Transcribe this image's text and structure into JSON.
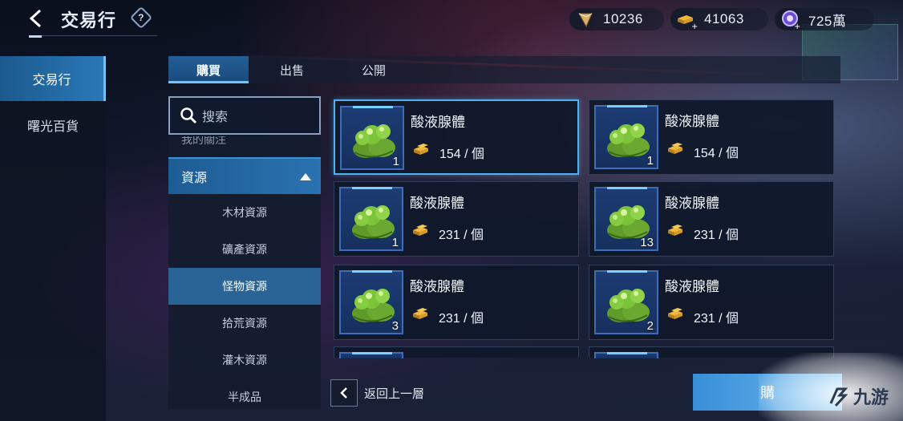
{
  "header": {
    "title": "交易行",
    "help": "?"
  },
  "currencies": [
    {
      "icon": "gem-icon",
      "value": "10236"
    },
    {
      "icon": "gold-bars-add-icon",
      "value": "41063"
    },
    {
      "icon": "crystal-add-icon",
      "value": "725萬"
    }
  ],
  "sidebar": {
    "items": [
      {
        "label": "交易行",
        "active": true
      },
      {
        "label": "曙光百貨",
        "active": false
      }
    ]
  },
  "tabs": [
    {
      "label": "購買",
      "active": true
    },
    {
      "label": "出售",
      "active": false
    },
    {
      "label": "公開",
      "active": false
    }
  ],
  "search": {
    "placeholder": "搜索"
  },
  "categories": {
    "cut_item": "我的關注",
    "group": "資源",
    "items": [
      {
        "label": "木材資源"
      },
      {
        "label": "礦產資源"
      },
      {
        "label": "怪物資源",
        "active": true
      },
      {
        "label": "拾荒資源"
      },
      {
        "label": "灌木資源"
      },
      {
        "label": "半成品"
      }
    ]
  },
  "listings": [
    {
      "name": "酸液腺體",
      "price": "154 / 個",
      "qty": "1"
    },
    {
      "name": "酸液腺體",
      "price": "154 / 個",
      "qty": "1"
    },
    {
      "name": "酸液腺體",
      "price": "231 / 個",
      "qty": "1"
    },
    {
      "name": "酸液腺體",
      "price": "231 / 個",
      "qty": "13"
    },
    {
      "name": "酸液腺體",
      "price": "231 / 個",
      "qty": "3"
    },
    {
      "name": "酸液腺體",
      "price": "231 / 個",
      "qty": "2"
    }
  ],
  "footer": {
    "back_level": "返回上一層",
    "buy_label": "購",
    "watermark": "九游"
  },
  "colors": {
    "accent": "#2a78b8",
    "highlight": "#4fb2f0",
    "gold": "#e0a030",
    "item_green": "#7cc43a"
  }
}
